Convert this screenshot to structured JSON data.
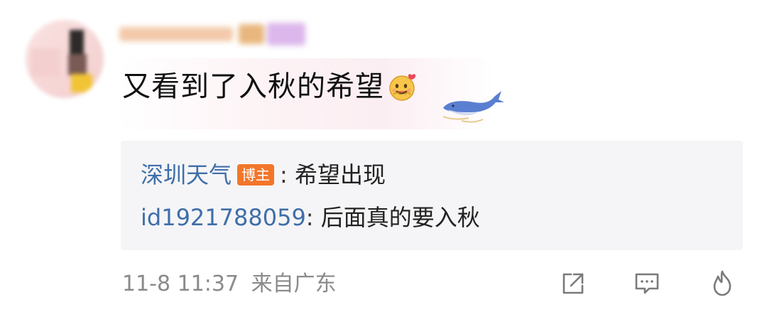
{
  "comment": {
    "text": "又看到了入秋的希望",
    "emoji": "happy-face-emoji"
  },
  "replies": [
    {
      "name": "深圳天气",
      "badge": "博主",
      "separator": ":",
      "text": "希望出现"
    },
    {
      "name": "id1921788059",
      "separator": ":",
      "text": "后面真的要入秋"
    }
  ],
  "meta": {
    "time": "11-8 11:37",
    "location": "来自广东"
  },
  "actions": {
    "share_icon": "share-icon",
    "comment_icon": "comment-icon",
    "like_icon": "like-icon"
  },
  "colors": {
    "reply_name": "#3f6ea8",
    "badge": "#f2762a",
    "meta_text": "#8a8a8a",
    "reply_bg": "#f5f5f7"
  }
}
